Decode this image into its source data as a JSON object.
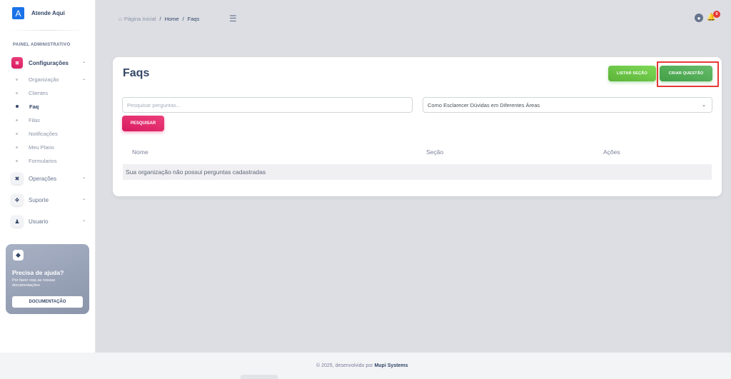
{
  "brand": {
    "logo_letter": "A",
    "name": "Atende Aqui"
  },
  "sidebar": {
    "section_title": "PAINEL ADMINISTRATIVO",
    "config": {
      "label": "Configurações",
      "icon": "grid-icon",
      "icon_text": "⊞"
    },
    "sub_items": [
      {
        "label": "Organização",
        "has_chevron": true
      },
      {
        "label": "Clientes"
      },
      {
        "label": "Faq",
        "active": true
      },
      {
        "label": "Filas"
      },
      {
        "label": "Notificações"
      },
      {
        "label": "Meu Plano"
      },
      {
        "label": "Formularios"
      }
    ],
    "other_items": [
      {
        "label": "Operações",
        "icon": "tools-icon"
      },
      {
        "label": "Suporte",
        "icon": "wrench-icon"
      },
      {
        "label": "Usuario",
        "icon": "user-plus-icon"
      }
    ],
    "help": {
      "title": "Precisa de ajuda?",
      "text": "Por favor veja as nossas documentações",
      "button": "DOCUMENTAÇÃO"
    }
  },
  "topbar": {
    "breadcrumb_home": "Página Inicial",
    "breadcrumb_current_section": "Home",
    "breadcrumb_page": "Faqs",
    "notification_count": "0"
  },
  "main": {
    "title": "Faqs",
    "list_sections_button": "LISTAR SEÇÃO",
    "create_question_button": "CRIAR QUESTÃO",
    "search_placeholder": "Pesquisar perguntas...",
    "section_selected": "Como Esclarecer Dúvidas em Diferentes Áreas",
    "search_button": "PESQUISAR",
    "table": {
      "columns": [
        "Nome",
        "Seção",
        "Ações"
      ],
      "empty_message": "Sua organização não possui perguntas cadastradas"
    }
  },
  "footer": {
    "text": "© 2025, desenvolvido por",
    "company": "Mupi Systems"
  },
  "colors": {
    "accent_pink": "#d81b60",
    "accent_green": "#43a047",
    "highlight_red": "#e53935",
    "brand_blue": "#1a73e8"
  }
}
